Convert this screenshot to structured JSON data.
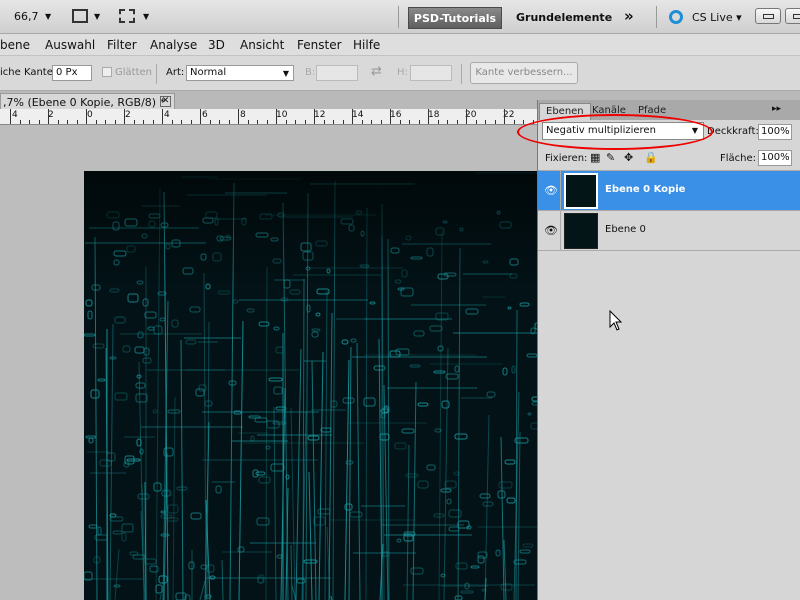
{
  "app_bar": {
    "zoom": "66,7",
    "workspace_active": "PSD-Tutorials",
    "workspace_label": "Grundelemente",
    "more": "»",
    "cs_live": "CS Live"
  },
  "menu": [
    "bene",
    "Auswahl",
    "Filter",
    "Analyse",
    "3D",
    "Ansicht",
    "Fenster",
    "Hilfe"
  ],
  "options": {
    "edge_label": "iche Kante:",
    "edge_value": "0 Px",
    "smooth_label": "Glätten",
    "style_label": "Art:",
    "style_value": "Normal",
    "width_label": "B:",
    "height_label": "H:",
    "refine_button": "Kante verbessern..."
  },
  "document": {
    "tab_title": ",7% (Ebene 0 Kopie, RGB/8) *"
  },
  "ruler": {
    "labels": [
      "4",
      "2",
      "0",
      "2",
      "4",
      "6",
      "8",
      "10",
      "12",
      "14",
      "16",
      "18",
      "20",
      "22"
    ]
  },
  "layers_panel": {
    "tabs": [
      "Ebenen",
      "Kanäle",
      "Pfade"
    ],
    "blend_mode": "Negativ multiplizieren",
    "opacity_label": "Deckkraft:",
    "opacity_value": "100%",
    "lock_label": "Fixieren:",
    "fill_label": "Fläche:",
    "fill_value": "100%",
    "layers": [
      {
        "name": "Ebene 0 Kopie",
        "selected": true
      },
      {
        "name": "Ebene 0",
        "selected": false
      }
    ]
  },
  "colors": {
    "selection": "#3a90e6",
    "highlight_ring": "#e00000",
    "canvas_line": "#1a9aa0"
  }
}
